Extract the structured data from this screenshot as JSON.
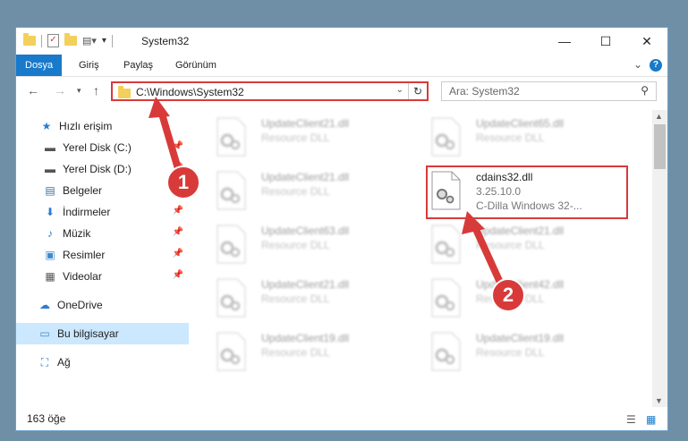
{
  "window": {
    "title": "System32",
    "minimize_glyph": "—",
    "maximize_glyph": "☐",
    "close_glyph": "✕"
  },
  "ribbon": {
    "tabs": [
      {
        "label": "Dosya",
        "active": true
      },
      {
        "label": "Giriş",
        "active": false
      },
      {
        "label": "Paylaş",
        "active": false
      },
      {
        "label": "Görünüm",
        "active": false
      }
    ],
    "help_glyph": "?"
  },
  "nav": {
    "address": "C:\\Windows\\System32",
    "search_placeholder": "Ara: System32"
  },
  "sidebar": {
    "items": [
      {
        "label": "Hızlı erişim",
        "icon": "star-icon",
        "glyph": "★",
        "color": "#2b7cd3",
        "pinned": false
      },
      {
        "label": "Yerel Disk (C:)",
        "icon": "drive-icon",
        "glyph": "▬",
        "color": "#555",
        "pinned": true
      },
      {
        "label": "Yerel Disk (D:)",
        "icon": "drive-icon",
        "glyph": "▬",
        "color": "#555",
        "pinned": true
      },
      {
        "label": "Belgeler",
        "icon": "documents-icon",
        "glyph": "▤",
        "color": "#3b6ea8",
        "pinned": true
      },
      {
        "label": "İndirmeler",
        "icon": "download-icon",
        "glyph": "⬇",
        "color": "#2b7cd3",
        "pinned": true
      },
      {
        "label": "Müzik",
        "icon": "music-icon",
        "glyph": "♪",
        "color": "#2b7cd3",
        "pinned": true
      },
      {
        "label": "Resimler",
        "icon": "pictures-icon",
        "glyph": "▣",
        "color": "#3b8bd1",
        "pinned": true
      },
      {
        "label": "Videolar",
        "icon": "videos-icon",
        "glyph": "▦",
        "color": "#555",
        "pinned": true
      },
      {
        "label": "OneDrive",
        "icon": "cloud-icon",
        "glyph": "☁",
        "color": "#2b7cd3",
        "pinned": false
      },
      {
        "label": "Bu bilgisayar",
        "icon": "computer-icon",
        "glyph": "▭",
        "color": "#3b8bd1",
        "pinned": false,
        "selected": true
      },
      {
        "label": "Ağ",
        "icon": "network-icon",
        "glyph": "⛶",
        "color": "#2b7cd3",
        "pinned": false
      }
    ]
  },
  "files": [
    {
      "name": "UpdateClient21.dll",
      "line2": "Resource DLL",
      "line3": "",
      "blurred": true
    },
    {
      "name": "UpdateClient65.dll",
      "line2": "Resource DLL",
      "line3": "",
      "blurred": true
    },
    {
      "name": "UpdateClient21.dll",
      "line2": "Resource DLL",
      "line3": "",
      "blurred": true
    },
    {
      "name": "cdains32.dll",
      "line2": "3.25.10.0",
      "line3": "C-Dilla Windows 32-...",
      "blurred": false
    },
    {
      "name": "UpdateClient63.dll",
      "line2": "Resource DLL",
      "line3": "",
      "blurred": true
    },
    {
      "name": "UpdateClient21.dll",
      "line2": "Resource DLL",
      "line3": "",
      "blurred": true
    },
    {
      "name": "UpdateClient21.dll",
      "line2": "Resource DLL",
      "line3": "",
      "blurred": true
    },
    {
      "name": "UpdateClient42.dll",
      "line2": "Resource DLL",
      "line3": "",
      "blurred": true
    },
    {
      "name": "UpdateClient19.dll",
      "line2": "Resource DLL",
      "line3": "",
      "blurred": true
    },
    {
      "name": "UpdateClient19.dll",
      "line2": "Resource DLL",
      "line3": "",
      "blurred": true
    }
  ],
  "status": {
    "count": "163 öğe"
  },
  "annotations": {
    "step1": "1",
    "step2": "2",
    "color": "#d83a3a"
  }
}
